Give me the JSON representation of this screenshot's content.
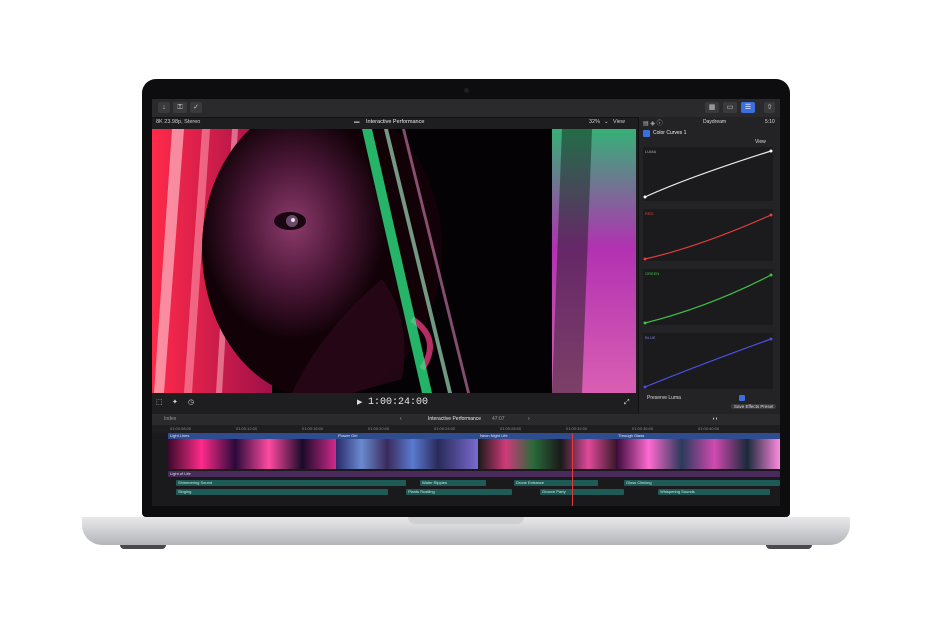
{
  "viewer": {
    "format": "8K 23.98p, Stereo",
    "project_title": "Interactive Performance",
    "zoom": "32%",
    "view_label": "View",
    "timecode": "1:00:24:00"
  },
  "inspector": {
    "clip_name": "Daydream",
    "duration": "5:10",
    "effect_name": "Color Curves 1",
    "view_label": "View",
    "curves": [
      "LUMA",
      "RED",
      "GREEN",
      "BLUE"
    ],
    "preserve_luma": "Preserve Luma",
    "save_preset": "Save Effects Preset"
  },
  "timeline": {
    "index_label": "Index",
    "project_title": "Interactive Performance",
    "duration": "47:07",
    "ruler": [
      "01:00:08:00",
      "01:00:12:00",
      "01:00:16:00",
      "01:00:20:00",
      "01:00:24:00",
      "01:00:28:00",
      "01:00:32:00",
      "01:00:36:00",
      "01:00:40:00"
    ],
    "video_clips": [
      "Light Lines",
      "Flower Girl",
      "Neon Night Life",
      "Through Glass"
    ],
    "title_lane": "Light of Life",
    "audio_row1": [
      "Shimmering Sound",
      "Water Ripples",
      "Drone Entrance",
      "Gloss Clinking"
    ],
    "audio_row2": [
      "Singing",
      "Plants Rustling",
      "Groove Party",
      "Whispering Sounds"
    ]
  },
  "colors": {
    "accent": "#3b6fe0",
    "clip_label": "#2e4c8f",
    "audio": "#1f5b56",
    "curve_red": "#e0403a",
    "curve_green": "#3fbf48",
    "curve_blue": "#4d4fe0"
  }
}
